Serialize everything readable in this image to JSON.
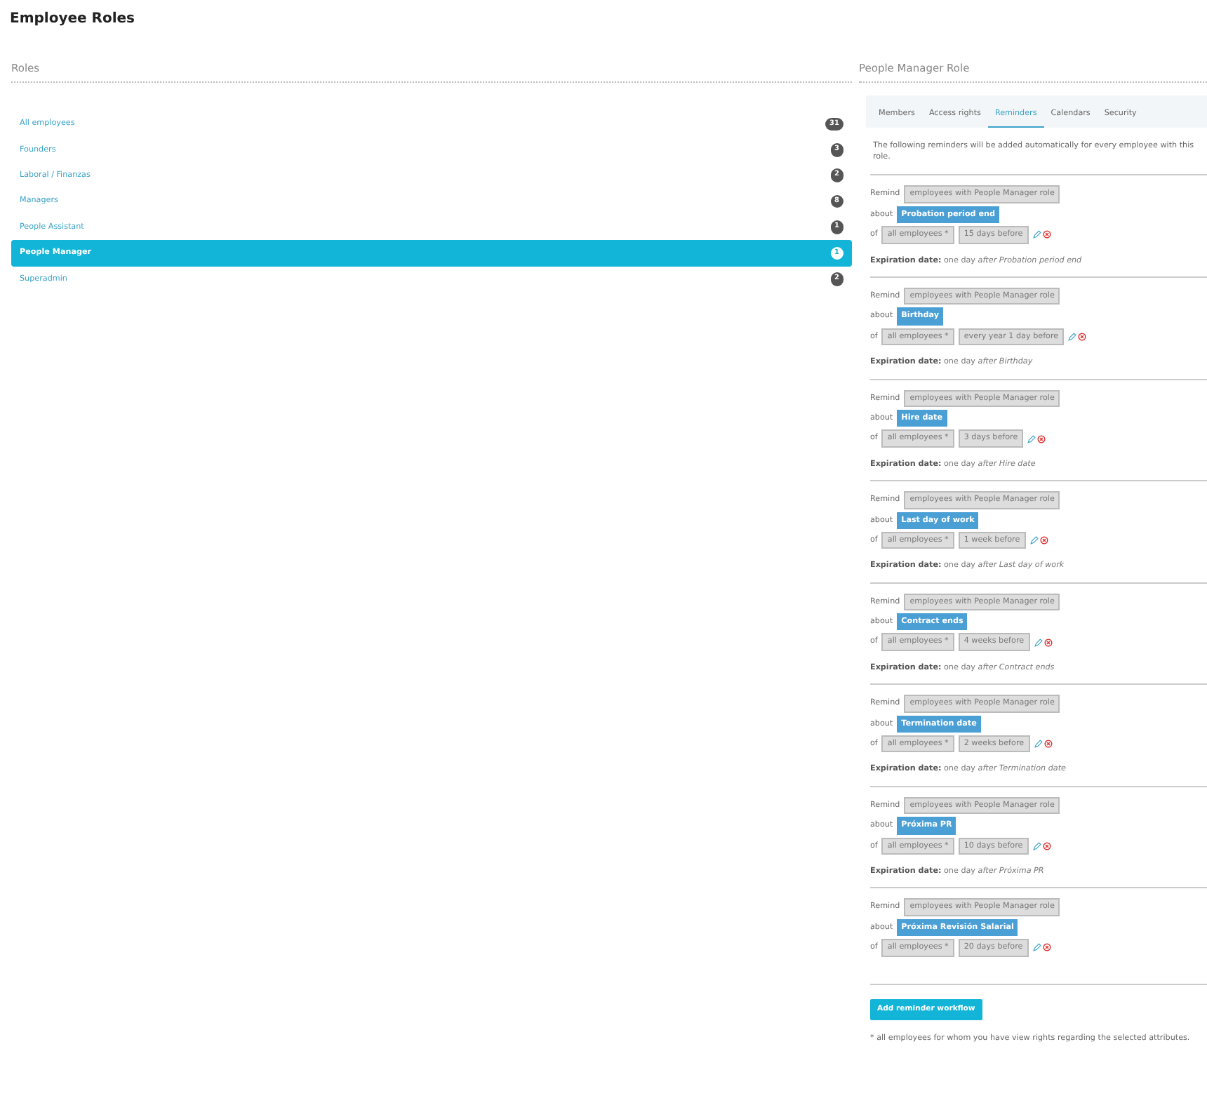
{
  "page_title": "Employee Roles",
  "roles_heading": "Roles",
  "roles": [
    {
      "name": "All employees",
      "count": "31",
      "selected": false
    },
    {
      "name": "Founders",
      "count": "3",
      "selected": false
    },
    {
      "name": "Laboral / Finanzas",
      "count": "2",
      "selected": false
    },
    {
      "name": "Managers",
      "count": "8",
      "selected": false
    },
    {
      "name": "People Assistant",
      "count": "1",
      "selected": false
    },
    {
      "name": "People Manager",
      "count": "1",
      "selected": true
    },
    {
      "name": "Superadmin",
      "count": "2",
      "selected": false
    }
  ],
  "detail_heading": "People Manager Role",
  "tabs": [
    {
      "label": "Members",
      "selected": false
    },
    {
      "label": "Access rights",
      "selected": false
    },
    {
      "label": "Reminders",
      "selected": true
    },
    {
      "label": "Calendars",
      "selected": false
    },
    {
      "label": "Security",
      "selected": false
    }
  ],
  "intro": "The following reminders will be added automatically for every employee with this role.",
  "reminders": [
    {
      "remind_label": "Remind",
      "who": "employees with People Manager role",
      "about_label": "about",
      "event": "Probation period end",
      "of_label": "of",
      "scope": "all employees *",
      "timing": "15 days before",
      "expiration": "**Expiration date:** one day *after* *Probation period end*"
    },
    {
      "remind_label": "Remind",
      "who": "employees with People Manager role",
      "about_label": "about",
      "event": "Birthday",
      "of_label": "of",
      "scope": "all employees *",
      "timing": "every year 1 day before",
      "expiration": "**Expiration date:** one day *after* *Birthday*"
    },
    {
      "remind_label": "Remind",
      "who": "employees with People Manager role",
      "about_label": "about",
      "event": "Hire date",
      "of_label": "of",
      "scope": "all employees *",
      "timing": "3 days before",
      "expiration": "**Expiration date:** one day *after* *Hire date*"
    },
    {
      "remind_label": "Remind",
      "who": "employees with People Manager role",
      "about_label": "about",
      "event": "Last day of work",
      "of_label": "of",
      "scope": "all employees *",
      "timing": "1 week before",
      "expiration": "**Expiration date:** one day *after* *Last day of work*"
    },
    {
      "remind_label": "Remind",
      "who": "employees with People Manager role",
      "about_label": "about",
      "event": "Contract ends",
      "of_label": "of",
      "scope": "all employees *",
      "timing": "4 weeks before",
      "expiration": "**Expiration date:** one day *after* *Contract ends*"
    },
    {
      "remind_label": "Remind",
      "who": "employees with People Manager role",
      "about_label": "about",
      "event": "Termination date",
      "of_label": "of",
      "scope": "all employees *",
      "timing": "2 weeks before",
      "expiration": "**Expiration date:** one day *after* *Termination date*"
    },
    {
      "remind_label": "Remind",
      "who": "employees with People Manager role",
      "about_label": "about",
      "event": "Próxima PR",
      "of_label": "of",
      "scope": "all employees *",
      "timing": "10 days before",
      "expiration": "**Expiration date:** one day *after* *Próxima PR*"
    },
    {
      "remind_label": "Remind",
      "who": "employees with People Manager role",
      "about_label": "about",
      "event": "Próxima Revisión Salarial",
      "of_label": "of",
      "scope": "all employees *",
      "timing": "20 days before"
    }
  ],
  "add_button": "Add reminder workflow",
  "footnote": "* all employees for whom you have view rights regarding the selected attributes."
}
